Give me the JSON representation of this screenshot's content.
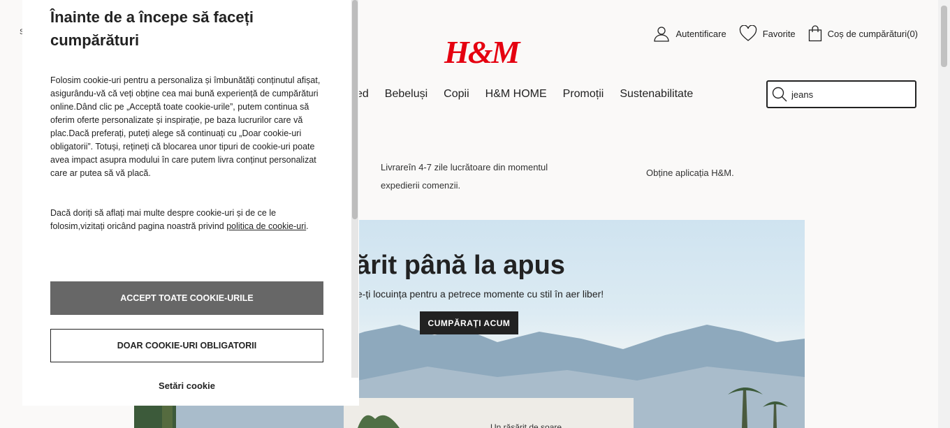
{
  "header": {
    "logo": "H&M",
    "small_label": "S",
    "account_label": "Autentificare",
    "favorites_label": "Favorite",
    "cart_label": "Coș de cumpărături(0)",
    "icons": [
      "user-icon",
      "heart-icon",
      "bag-icon",
      "search-icon"
    ]
  },
  "nav": {
    "categories": [
      "ed",
      "Bebeluși",
      "Copii",
      "H&M HOME",
      "Promoții",
      "Sustenabilitate"
    ]
  },
  "search": {
    "value": "jeans"
  },
  "info": {
    "delivery": "Livrareîn 4-7 zile lucrătoare din momentul expedierii comenzii.",
    "app": "Obține aplicația H&M."
  },
  "hero": {
    "title": "răsărit până la apus",
    "title_prefix": "",
    "subtitle": "te-ți locuința pentru a petrece momente cu stil în aer liber!",
    "button": "CUMPĂRAȚI ACUM",
    "bottom_text": "Un răsărit de soare"
  },
  "cookie": {
    "title": "Înainte de a începe să faceți cumpărături",
    "paragraph1": "Folosim cookie-uri pentru a personaliza și îmbunătăți conținutul afișat, asigurându-vă că veți obține cea mai bună experiență de cumpărături online.Dând clic pe „Acceptă toate cookie-urile”, putem continua să oferim oferte personalizate și inspirație, pe baza lucrurilor care vă plac.Dacă preferați, puteți alege să continuați cu „Doar cookie-uri obligatorii”. Totuși, rețineți că blocarea unor tipuri de cookie-uri poate avea impact asupra modului în care putem livra conținut personalizat care ar putea să vă placă.",
    "paragraph2_text": "Dacă doriți să aflați mai multe despre cookie-uri și de ce le folosim,vizitați oricând pagina noastră privind ",
    "paragraph2_link": "politica de cookie-uri",
    "paragraph2_end": ".",
    "accept_button": "ACCEPT TOATE COOKIE-URILE",
    "required_button": "DOAR COOKIE-URI OBLIGATORII",
    "settings_link": "Setări cookie"
  },
  "colors": {
    "brand_red": "#e50010",
    "accept_bg": "#676767",
    "dark": "#222222",
    "page_bg": "#faf9f8"
  }
}
